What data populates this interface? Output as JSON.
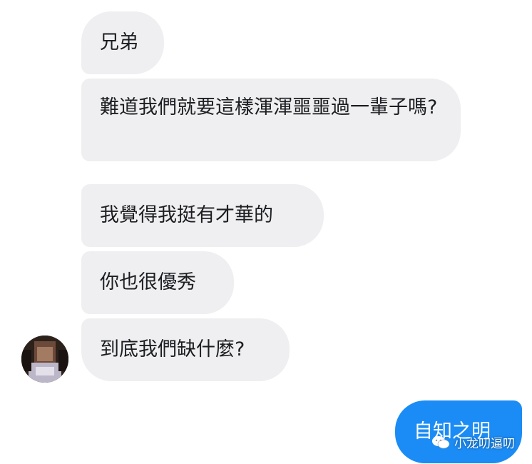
{
  "messages": [
    {
      "text": "兄弟"
    },
    {
      "text": "難道我們就要這樣渾渾噩噩過一輩子嗎?"
    },
    {
      "text": "我覺得我挺有才華的"
    },
    {
      "text": "你也很優秀"
    },
    {
      "text": "到底我們缺什麼?"
    }
  ],
  "reply": {
    "text": "自知之明"
  },
  "watermark": {
    "text": "小龙叨逼叨"
  },
  "colors": {
    "incoming_bubble": "#efeff1",
    "outgoing_bubble": "#1b8cf5",
    "text": "#1c1e21"
  }
}
